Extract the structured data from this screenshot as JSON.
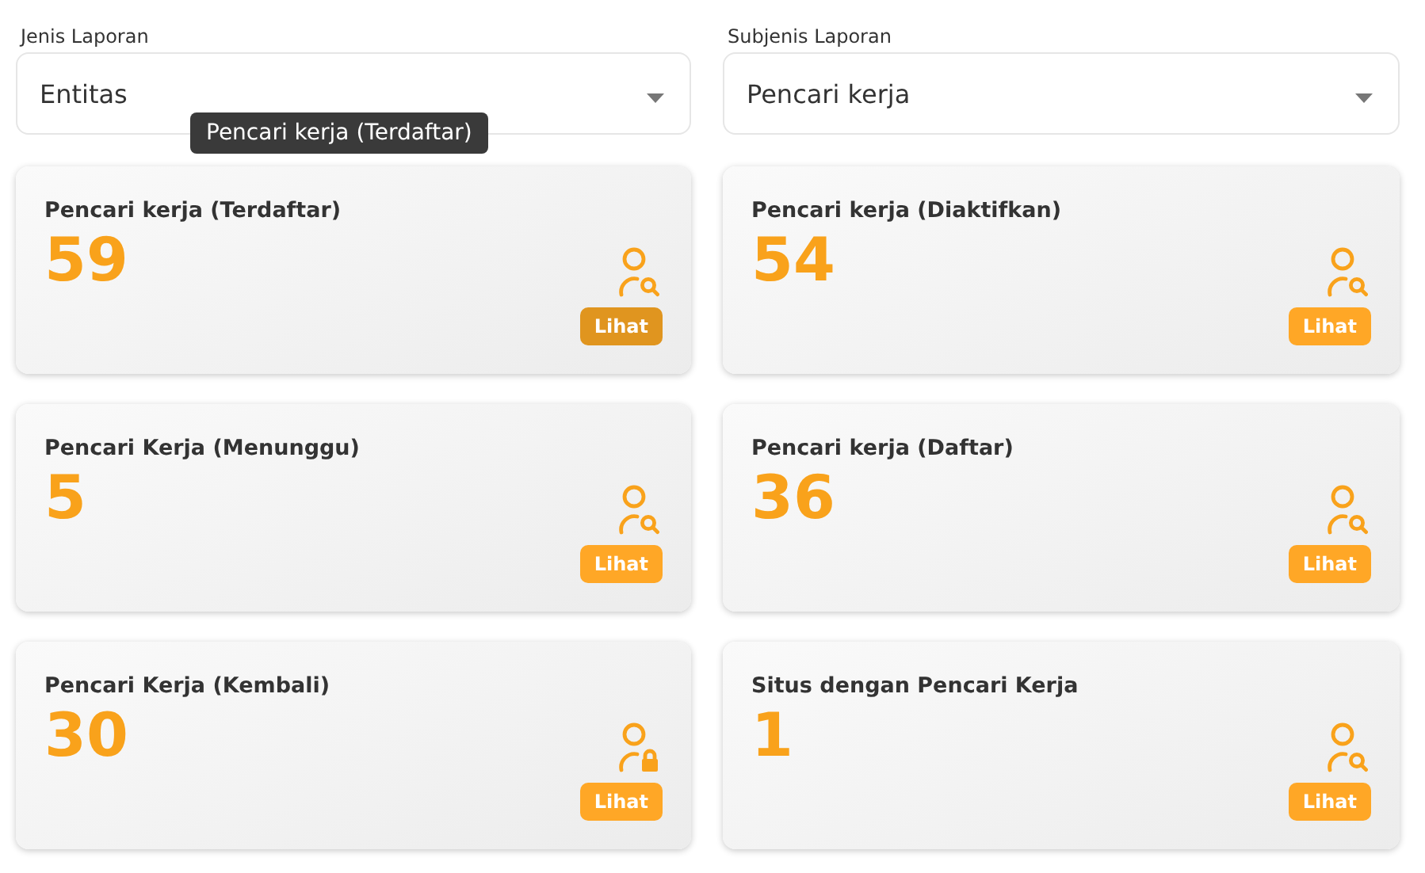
{
  "filters": [
    {
      "label": "Jenis Laporan",
      "value": "Entitas"
    },
    {
      "label": "Subjenis Laporan",
      "value": "Pencari kerja"
    }
  ],
  "tooltip": "Pencari kerja (Terdaftar)",
  "cards": [
    {
      "title": "Pencari kerja (Terdaftar)",
      "count": "59",
      "kind": "search",
      "button": "Lihat",
      "pressed": true
    },
    {
      "title": "Pencari kerja (Diaktifkan)",
      "count": "54",
      "kind": "search",
      "button": "Lihat",
      "pressed": false
    },
    {
      "title": "Pencari Kerja (Menunggu)",
      "count": "5",
      "kind": "search",
      "button": "Lihat",
      "pressed": false
    },
    {
      "title": "Pencari kerja (Daftar)",
      "count": "36",
      "kind": "search",
      "button": "Lihat",
      "pressed": false
    },
    {
      "title": "Pencari Kerja (Kembali)",
      "count": "30",
      "kind": "lock",
      "button": "Lihat",
      "pressed": false
    },
    {
      "title": "Situs dengan Pencari Kerja",
      "count": "1",
      "kind": "search",
      "button": "Lihat",
      "pressed": false
    }
  ]
}
